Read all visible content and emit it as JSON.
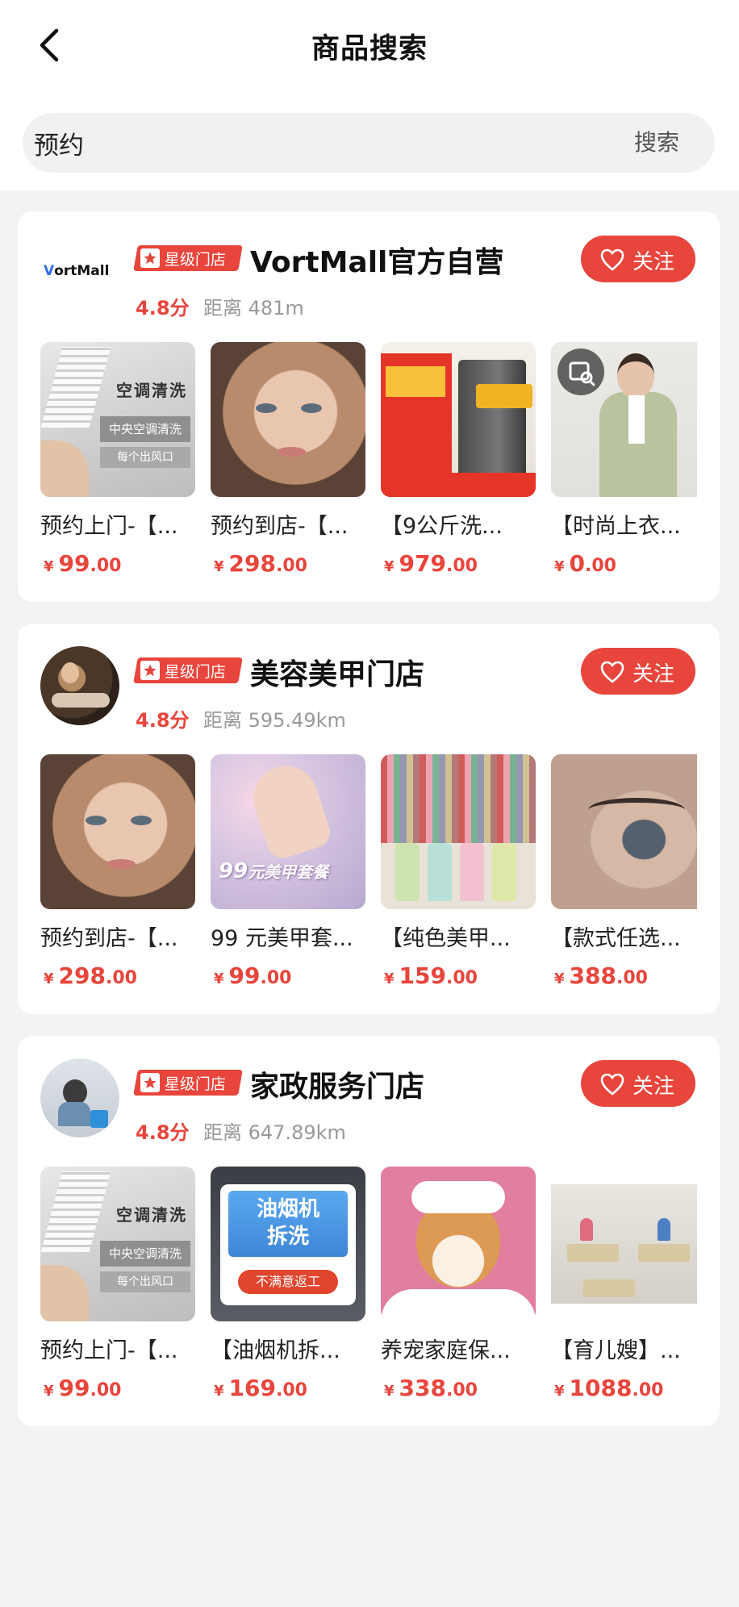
{
  "header": {
    "title": "商品搜索",
    "back_icon": "chevron-left-icon"
  },
  "search": {
    "value": "预约",
    "button_label": "搜索"
  },
  "colors": {
    "accent": "#e8453c",
    "price": "#e8453c",
    "page_bg": "#f3f3f5"
  },
  "stores": [
    {
      "badge": "星级门店",
      "name": "VortMall官方自营",
      "logo_text_prefix": "V",
      "logo_text_rest": "ortMall",
      "rating": "4.8分",
      "distance": "距离 481m",
      "follow_label": "关注",
      "products": [
        {
          "name": "预约上门-【...",
          "currency": "¥",
          "price_int": "99",
          "price_dec": ".00",
          "img_caption_1": "空调清洗",
          "img_caption_2": "中央空调清洗",
          "img_caption_3": "每个出风口"
        },
        {
          "name": "预约到店-【...",
          "currency": "¥",
          "price_int": "298",
          "price_dec": ".00"
        },
        {
          "name": "【9公斤洗...",
          "currency": "¥",
          "price_int": "979",
          "price_dec": ".00"
        },
        {
          "name": "【时尚上衣...",
          "currency": "¥",
          "price_int": "0",
          "price_dec": ".00"
        }
      ]
    },
    {
      "badge": "星级门店",
      "name": "美容美甲门店",
      "rating": "4.8分",
      "distance": "距离 595.49km",
      "follow_label": "关注",
      "products": [
        {
          "name": "预约到店-【...",
          "currency": "¥",
          "price_int": "298",
          "price_dec": ".00"
        },
        {
          "name": "99 元美甲套...",
          "currency": "¥",
          "price_int": "99",
          "price_dec": ".00",
          "img_caption_big": "99",
          "img_caption_small": "元美甲套餐"
        },
        {
          "name": "【纯色美甲...",
          "currency": "¥",
          "price_int": "159",
          "price_dec": ".00"
        },
        {
          "name": "【款式任选...",
          "currency": "¥",
          "price_int": "388",
          "price_dec": ".00"
        }
      ]
    },
    {
      "badge": "星级门店",
      "name": "家政服务门店",
      "rating": "4.8分",
      "distance": "距离 647.89km",
      "follow_label": "关注",
      "products": [
        {
          "name": "预约上门-【...",
          "currency": "¥",
          "price_int": "99",
          "price_dec": ".00",
          "img_caption_1": "空调清洗",
          "img_caption_2": "中央空调清洗",
          "img_caption_3": "每个出风口"
        },
        {
          "name": "【油烟机拆...",
          "currency": "¥",
          "price_int": "169",
          "price_dec": ".00",
          "img_caption_1": "油烟机",
          "img_caption_2": "拆洗",
          "img_caption_3": "不满意返工"
        },
        {
          "name": "养宠家庭保...",
          "currency": "¥",
          "price_int": "338",
          "price_dec": ".00"
        },
        {
          "name": "【育儿嫂】...",
          "currency": "¥",
          "price_int": "1088",
          "price_dec": ".00"
        }
      ]
    }
  ]
}
